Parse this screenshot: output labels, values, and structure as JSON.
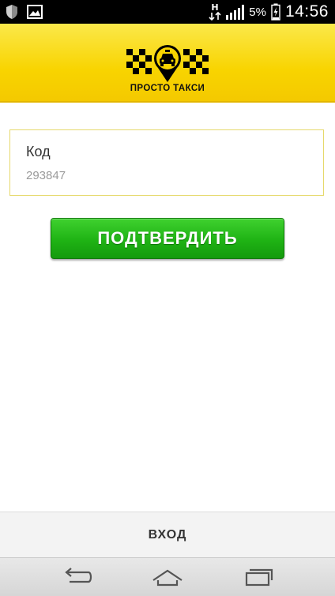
{
  "status_bar": {
    "time": "14:56",
    "battery_percent": "5%",
    "icons": [
      "shield-icon",
      "image-icon",
      "hplus-data-icon",
      "signal-icon",
      "battery-charging-icon"
    ]
  },
  "header": {
    "logo_text": "ПРОСТО ТАКСИ",
    "colors": {
      "header": "#f8d400",
      "logo_pin": "#f8d400",
      "checker": "#000000"
    }
  },
  "form": {
    "code_label": "Код",
    "code_placeholder": "293847",
    "confirm_label": "ПОДТВЕРДИТЬ",
    "colors": {
      "button": "#1fb314",
      "field_border": "#e6d96b"
    }
  },
  "footer": {
    "login_label": "ВХОД"
  },
  "nav_bar": {
    "buttons": [
      "back-icon",
      "home-icon",
      "recent-apps-icon"
    ]
  }
}
